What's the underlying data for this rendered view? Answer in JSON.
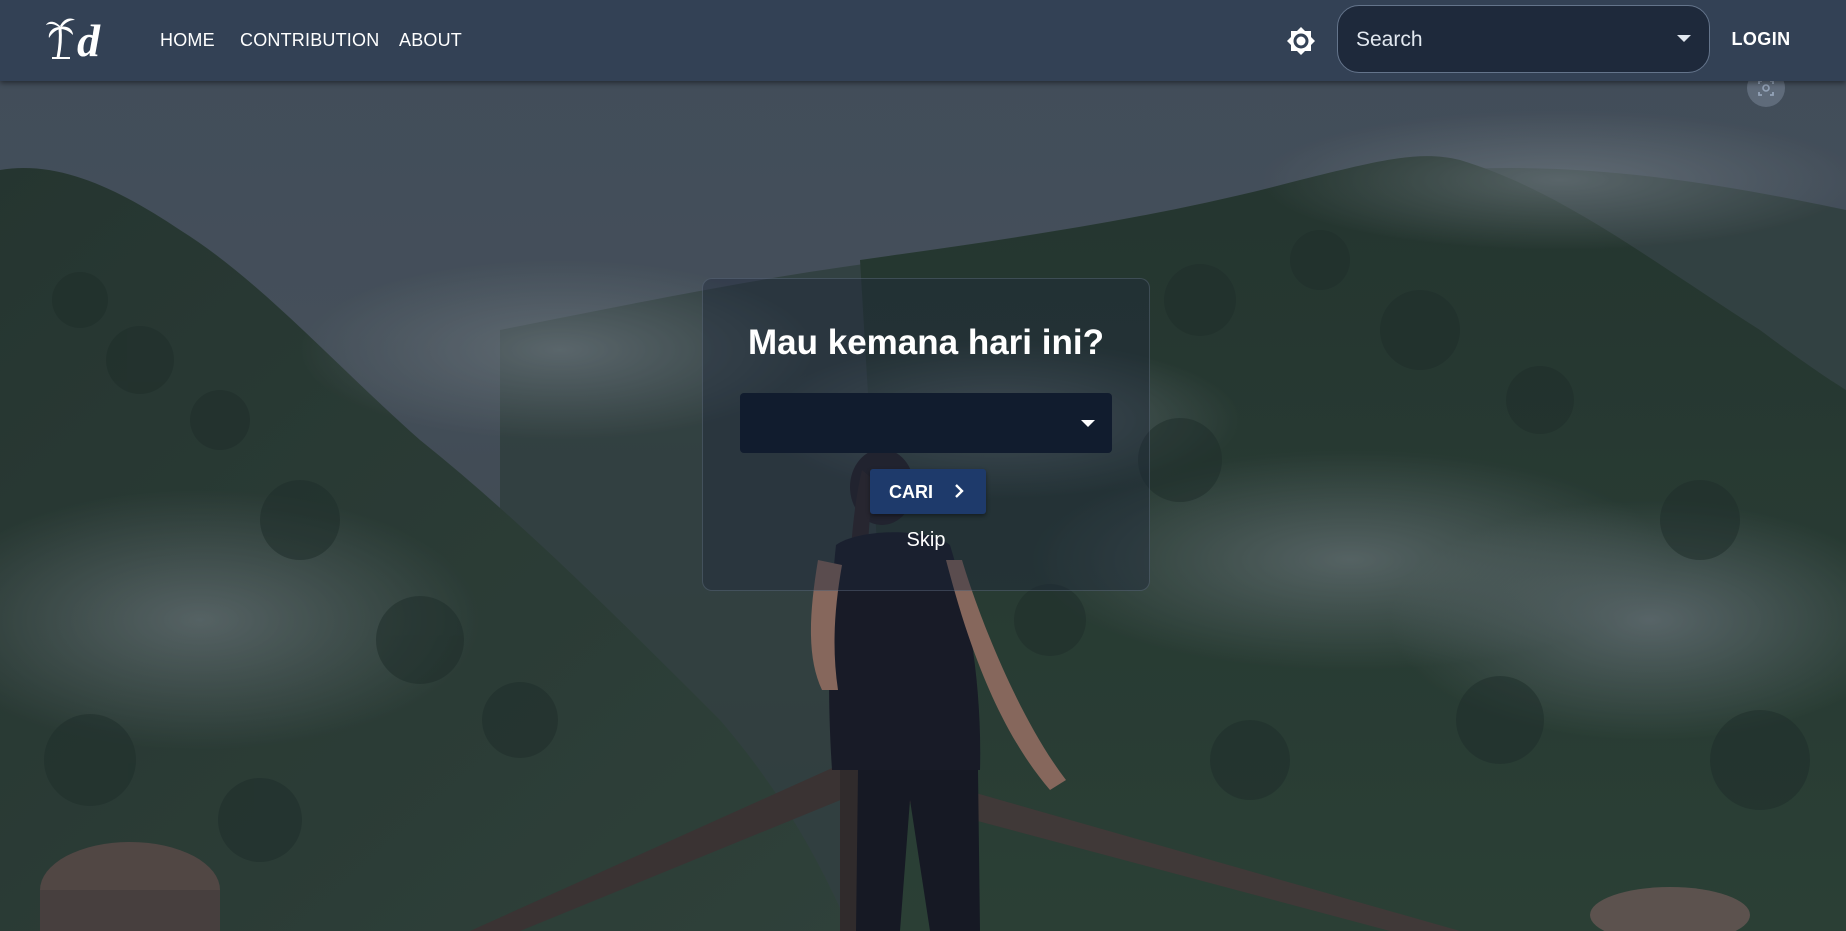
{
  "navbar": {
    "logo_alt": "d",
    "links": [
      "HOME",
      "CONTRIBUTION",
      "ABOUT"
    ],
    "theme_icon": "sun-icon",
    "search": {
      "placeholder": "Search",
      "value": ""
    },
    "login_label": "LOGIN"
  },
  "floating": {
    "scan_icon": "scan-icon"
  },
  "hero": {
    "title": "Mau kemana hari ini?",
    "destination_select": {
      "value": ""
    },
    "search_button_label": "CARI",
    "search_button_icon": "chevron-right-icon",
    "skip_label": "Skip"
  },
  "colors": {
    "navbar": "#334155",
    "search_bg": "#1e293b",
    "select_bg": "#111c2e",
    "button_bg": "#1e3a6b",
    "text": "#ffffff"
  }
}
